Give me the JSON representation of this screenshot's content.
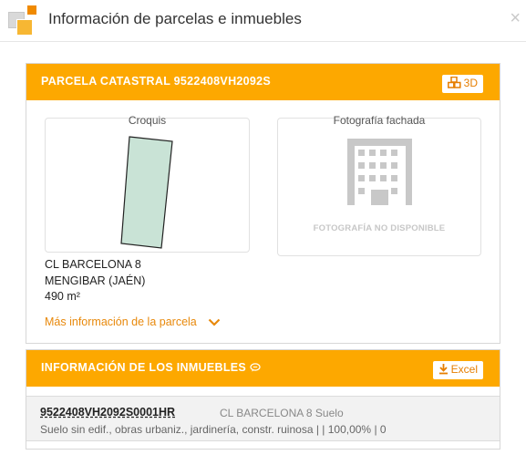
{
  "header": {
    "title": "Información de parcelas e inmuebles",
    "close": "×"
  },
  "parcela": {
    "title": "PARCELA CATASTRAL 9522408VH2092S",
    "btn_3d_label": "3D",
    "croquis_label": "Croquis",
    "fachada_label": "Fotografía fachada",
    "no_photo": "FOTOGRAFÍA NO DISPONIBLE",
    "address_line1": "CL BARCELONA 8",
    "address_line2": "MENGIBAR (JAÉN)",
    "area": "490 m²",
    "more_info": "Más información de la parcela"
  },
  "inmuebles": {
    "title": "INFORMACIÓN DE LOS INMUEBLES",
    "excel_label": "Excel",
    "rows": [
      {
        "ref": "9522408VH2092S0001HR",
        "address": "CL BARCELONA 8 Suelo",
        "detail": "Suelo sin edif., obras urbaniz., jardinería, constr. ruinosa | | 100,00% | 0"
      }
    ]
  },
  "colors": {
    "accent": "#fda800",
    "link": "#e8890c",
    "parcel_fill": "#c9e3d6"
  },
  "icons": [
    "app-logo-icon",
    "close-icon",
    "cubes-3d-icon",
    "chat-bubble-icon",
    "download-icon",
    "chevron-down-icon",
    "building-icon"
  ]
}
